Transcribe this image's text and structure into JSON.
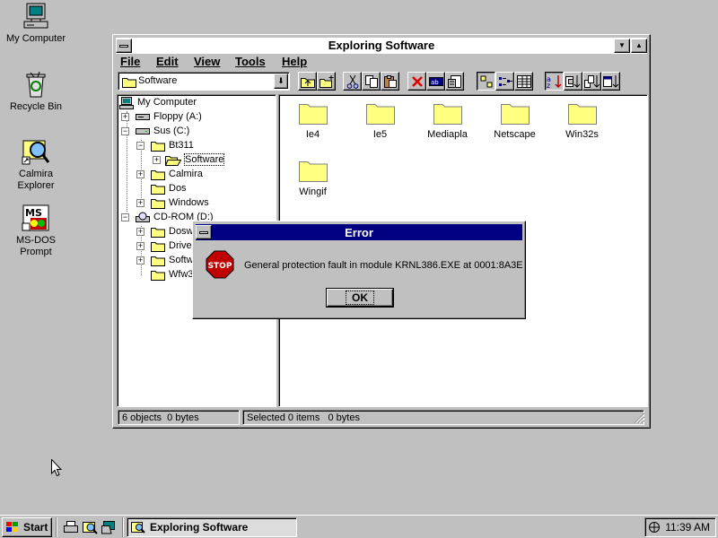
{
  "desktop": {
    "icons": [
      {
        "label": "My Computer",
        "icon": "my-computer-icon"
      },
      {
        "label": "Recycle Bin",
        "icon": "recycle-bin-icon"
      },
      {
        "label": "Calmira Explorer",
        "line1": "Calmira",
        "line2": "Explorer",
        "icon": "magnifier-icon"
      },
      {
        "label": "MS-DOS Prompt",
        "line1": "MS-DOS",
        "line2": "Prompt",
        "icon": "msdos-icon"
      }
    ]
  },
  "window": {
    "title": "Exploring Software",
    "menu": [
      "File",
      "Edit",
      "View",
      "Tools",
      "Help"
    ],
    "address": {
      "value": "Software"
    },
    "tree": [
      {
        "label": "My Computer",
        "depth": 0
      },
      {
        "label": "Floppy (A:)",
        "depth": 1,
        "expander": "+"
      },
      {
        "label": "Sus (C:)",
        "depth": 1,
        "expander": "−"
      },
      {
        "label": "Bt311",
        "depth": 2,
        "expander": "−"
      },
      {
        "label": "Software",
        "depth": 3,
        "expander": "+"
      },
      {
        "label": "Calmira",
        "depth": 2,
        "expander": "+"
      },
      {
        "label": "Dos",
        "depth": 2
      },
      {
        "label": "Windows",
        "depth": 2,
        "expander": "+"
      },
      {
        "label": "CD-ROM (D:)",
        "depth": 1,
        "expander": "−"
      },
      {
        "label": "Dosw",
        "depth": 2,
        "expander": "+"
      },
      {
        "label": "Drive",
        "depth": 2,
        "expander": "+"
      },
      {
        "label": "Softw",
        "depth": 2,
        "expander": "+"
      },
      {
        "label": "Wfw3",
        "depth": 2
      }
    ],
    "folders": [
      "Ie4",
      "Ie5",
      "Mediapla",
      "Netscape",
      "Win32s",
      "Wingif"
    ],
    "status": {
      "objects": "6 objects",
      "bytes_left": "0 bytes",
      "selected": "Selected 0 items",
      "bytes_right": "0 bytes"
    }
  },
  "dialog": {
    "title": "Error",
    "stop_label": "STOP",
    "message": "General protection fault in module KRNL386.EXE at 0001:8A3E",
    "ok_label": "OK"
  },
  "taskbar": {
    "start_label": "Start",
    "task_label": "Exploring Software",
    "clock": "11:39 AM"
  },
  "colors": {
    "face": "#c0c0c0",
    "active_title": "#000080",
    "folder": "#ffff80",
    "stop": "#c00000"
  }
}
